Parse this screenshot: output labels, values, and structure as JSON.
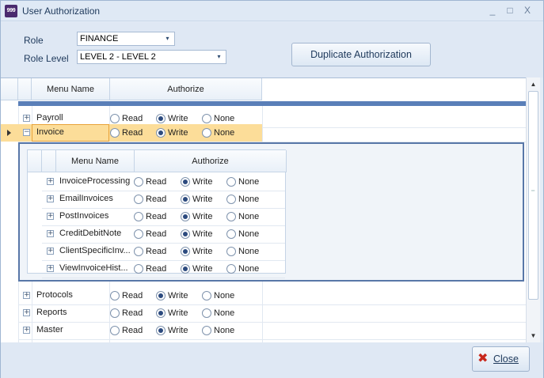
{
  "window": {
    "title": "User Authorization",
    "icon_label": "999",
    "buttons": [
      "_",
      "□",
      "X"
    ]
  },
  "filters": {
    "role_label": "Role",
    "role_value": "FINANCE",
    "role_level_label": "Role Level",
    "role_level_value": "LEVEL 2 - LEVEL 2",
    "dropdown_glyph": "▾"
  },
  "duplicate_button": "Duplicate Authorization",
  "grid": {
    "columns": [
      "Menu Name",
      "Authorize"
    ],
    "radio_labels": [
      "Read",
      "Write",
      "None"
    ],
    "expand_glyph": "+",
    "collapse_glyph": "−",
    "rows_before": [
      {
        "name": "Payroll",
        "selected": "Write"
      }
    ],
    "selected_row": {
      "name": "Invoice",
      "selected": "Write"
    },
    "detail": {
      "columns": [
        "Menu Name",
        "Authorize"
      ],
      "rows": [
        {
          "name": "InvoiceProcessing",
          "selected": "Write"
        },
        {
          "name": "EmailInvoices",
          "selected": "Write"
        },
        {
          "name": "PostInvoices",
          "selected": "Write"
        },
        {
          "name": "CreditDebitNote",
          "selected": "Write"
        },
        {
          "name": "ClientSpecificInv...",
          "selected": "Write"
        },
        {
          "name": "ViewInvoiceHist...",
          "selected": "Write"
        }
      ]
    },
    "rows_after": [
      {
        "name": "Protocols",
        "selected": "Write"
      },
      {
        "name": "Reports",
        "selected": "Write"
      },
      {
        "name": "Master",
        "selected": "Write"
      }
    ]
  },
  "close_button": {
    "icon": "✖",
    "label": "Close"
  },
  "colors": {
    "selection": "#fcdd99",
    "accent": "#5877a8",
    "close_icon": "#c8281c"
  }
}
